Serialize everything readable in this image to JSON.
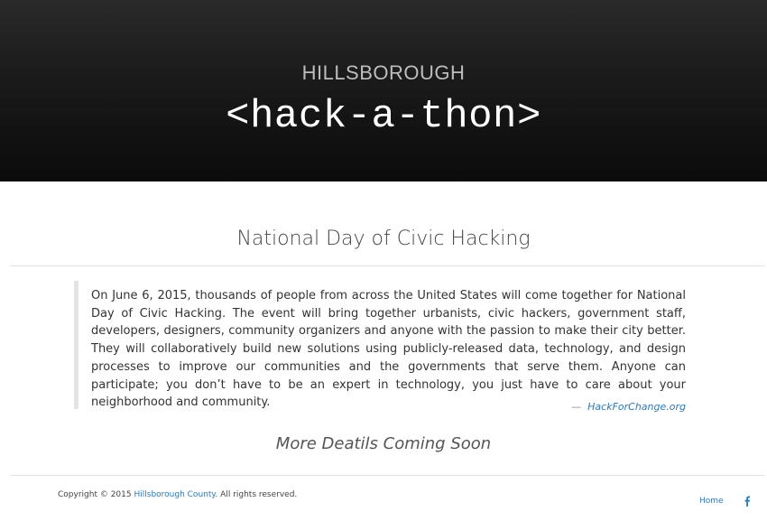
{
  "hero": {
    "subtitle": "HILLSBOROUGH",
    "title": "<hack-a-thon>"
  },
  "main": {
    "section_title": "National Day of Civic Hacking",
    "quote": "On June 6, 2015, thousands of people from across the United States will come together for National Day of Civic Hacking. The event will bring together urbanists, civic hackers, government staff, developers, designers, community organizers and anyone with the passion to make their city better. They will collaboratively build new solutions using publicly-released data, technology, and design processes to improve our communities and the governments that serve them. Anyone can participate; you don’t have to be an expert in technology, you just have to care about your neighborhood and community.",
    "cite_dash": "—",
    "cite_link": "HackForChange.org",
    "coming_soon": "More Deatils Coming Soon"
  },
  "footer": {
    "copy_prefix": "Copyright © 2015",
    "copy_link": "Hillsborough County",
    "copy_suffix": ". All rights reserved.",
    "nav_home": "Home",
    "facebook_icon": "facebook-icon"
  },
  "colors": {
    "link": "#2a7ac0",
    "hero_top": "#2a2a2a",
    "hero_bottom": "#0b0b0b"
  }
}
